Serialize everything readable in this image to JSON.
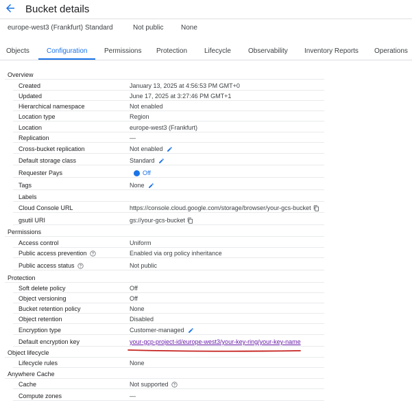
{
  "header": {
    "title": "Bucket details"
  },
  "summary": {
    "location": "europe-west3 (Frankfurt)",
    "storage_class": "Standard",
    "public_access": "Not public",
    "protection": "None"
  },
  "tabs": [
    {
      "label": "Objects"
    },
    {
      "label": "Configuration"
    },
    {
      "label": "Permissions"
    },
    {
      "label": "Protection"
    },
    {
      "label": "Lifecycle"
    },
    {
      "label": "Observability"
    },
    {
      "label": "Inventory Reports"
    },
    {
      "label": "Operations"
    }
  ],
  "active_tab": "Configuration",
  "sections": {
    "overview": {
      "title": "Overview",
      "created": {
        "key": "Created",
        "value": "January 13, 2025 at 4:56:53 PM GMT+0"
      },
      "updated": {
        "key": "Updated",
        "value": "June 17, 2025 at 3:27:46 PM GMT+1"
      },
      "hns": {
        "key": "Hierarchical namespace",
        "value": "Not enabled"
      },
      "location_type": {
        "key": "Location type",
        "value": "Region"
      },
      "location": {
        "key": "Location",
        "value": "europe-west3 (Frankfurt)"
      },
      "replication": {
        "key": "Replication",
        "value": "—"
      },
      "cross_bucket": {
        "key": "Cross-bucket replication",
        "value": "Not enabled"
      },
      "storage_class": {
        "key": "Default storage class",
        "value": "Standard"
      },
      "requester_pays": {
        "key": "Requester Pays",
        "value": "Off"
      },
      "tags": {
        "key": "Tags",
        "value": "None"
      },
      "labels": {
        "key": "Labels",
        "value": ""
      },
      "console_url": {
        "key": "Cloud Console URL",
        "value": "https://console.cloud.google.com/storage/browser/your-gcs-bucket"
      },
      "gsutil_uri": {
        "key": "gsutil URI",
        "value": "gs://your-gcs-bucket"
      }
    },
    "permissions": {
      "title": "Permissions",
      "access_control": {
        "key": "Access control",
        "value": "Uniform"
      },
      "public_prevention": {
        "key": "Public access prevention",
        "value": "Enabled via org policy inheritance"
      },
      "public_status": {
        "key": "Public access status",
        "value": "Not public"
      }
    },
    "protection": {
      "title": "Protection",
      "soft_delete": {
        "key": "Soft delete policy",
        "value": "Off"
      },
      "versioning": {
        "key": "Object versioning",
        "value": "Off"
      },
      "retention_policy": {
        "key": "Bucket retention policy",
        "value": "None"
      },
      "object_retention": {
        "key": "Object retention",
        "value": "Disabled"
      },
      "encryption_type": {
        "key": "Encryption type",
        "value": "Customer-managed"
      },
      "encryption_key": {
        "key": "Default encryption key",
        "value": "your-gcp-project-id/europe-west3/your-key-ring/your-key-name"
      }
    },
    "lifecycle": {
      "title": "Object lifecycle",
      "rules": {
        "key": "Lifecycle rules",
        "value": "None"
      }
    },
    "anywhere_cache": {
      "title": "Anywhere Cache",
      "cache": {
        "key": "Cache",
        "value": "Not supported"
      },
      "compute_zones": {
        "key": "Compute zones",
        "value": "—"
      }
    }
  },
  "colors": {
    "accent": "#1a73e8",
    "link_visited": "#681da8",
    "annotation": "#c5221f"
  }
}
